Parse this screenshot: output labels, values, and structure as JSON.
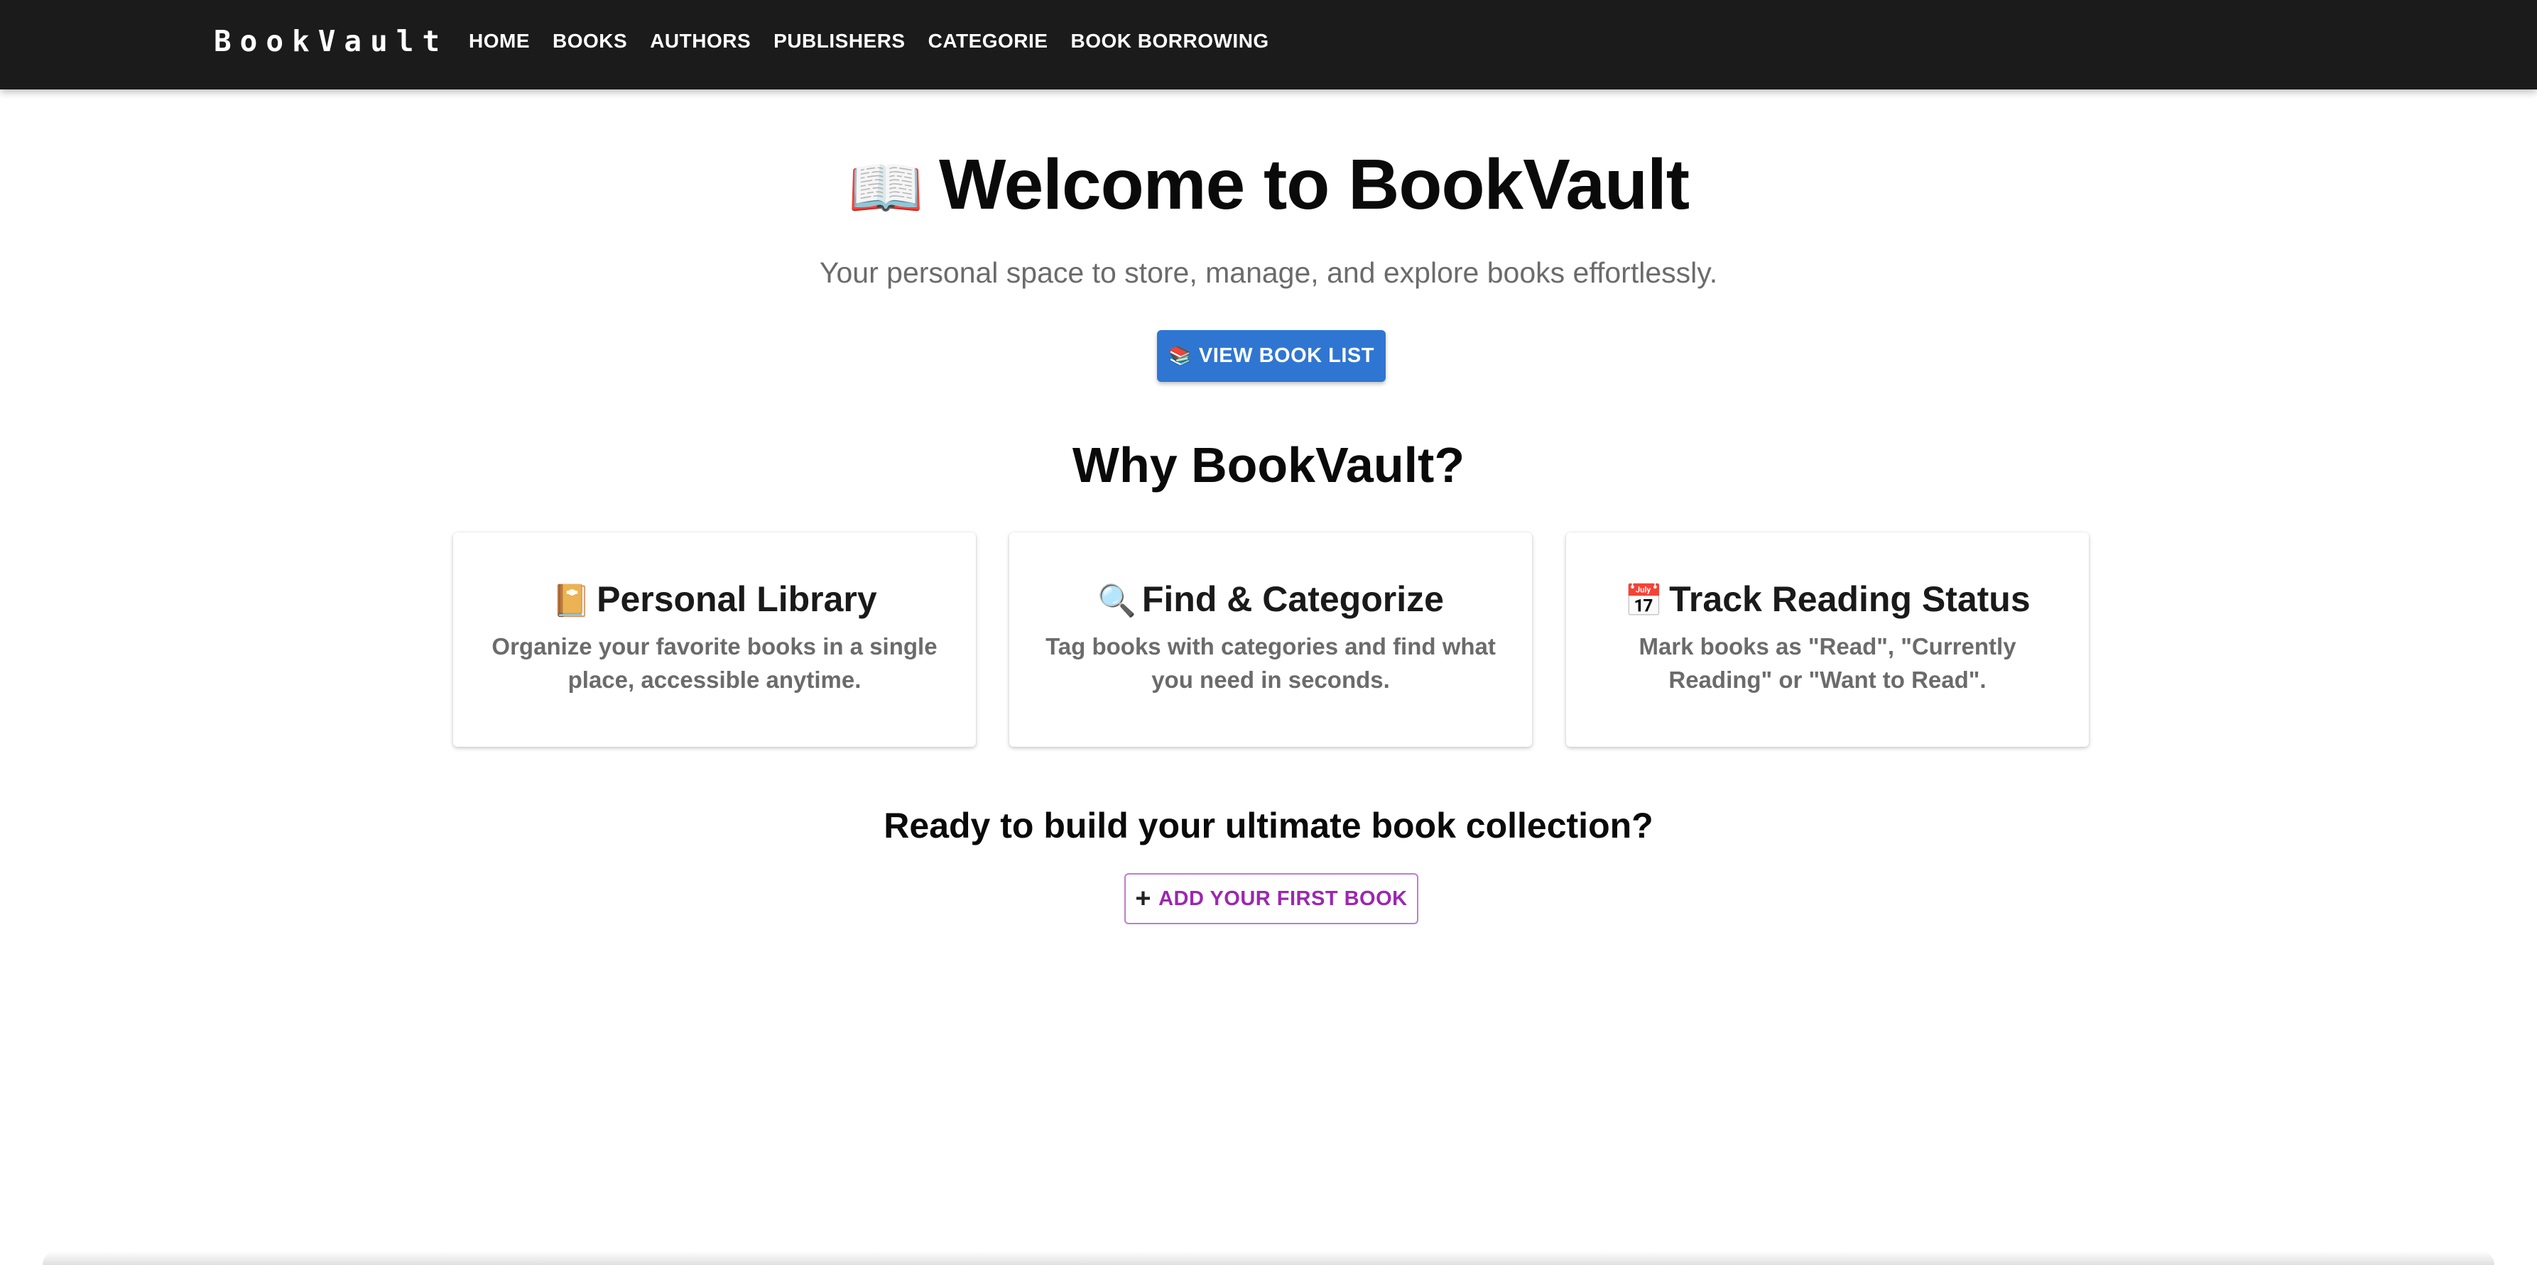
{
  "brand": {
    "name": "BookVault"
  },
  "nav": {
    "items": [
      {
        "label": "HOME"
      },
      {
        "label": "BOOKS"
      },
      {
        "label": "AUTHORS"
      },
      {
        "label": "PUBLISHERS"
      },
      {
        "label": "CATEGORIE"
      },
      {
        "label": "BOOK BORROWING"
      }
    ]
  },
  "hero": {
    "icon": "📖",
    "title": "Welcome to BookVault",
    "subtitle": "Your personal space to store, manage, and explore books effortlessly.",
    "button_icon": "📚",
    "button_label": "VIEW BOOK LIST"
  },
  "features": {
    "title": "Why BookVault?",
    "cards": [
      {
        "icon": "📔",
        "title": "Personal Library",
        "description": "Organize your favorite books in a single place, accessible anytime."
      },
      {
        "icon": "🔍",
        "title": "Find & Categorize",
        "description": "Tag books with categories and find what you need in seconds."
      },
      {
        "icon": "📅",
        "title": "Track Reading Status",
        "description": "Mark books as \"Read\", \"Currently Reading\" or \"Want to Read\"."
      }
    ]
  },
  "cta": {
    "title": "Ready to build your ultimate book collection?",
    "button_icon": "+",
    "button_label": "ADD YOUR FIRST BOOK"
  },
  "colors": {
    "appbar": "#1b1b1b",
    "primary": "#2f76d2",
    "secondary": "#9c27b0",
    "muted_text": "#6b6b6b"
  }
}
